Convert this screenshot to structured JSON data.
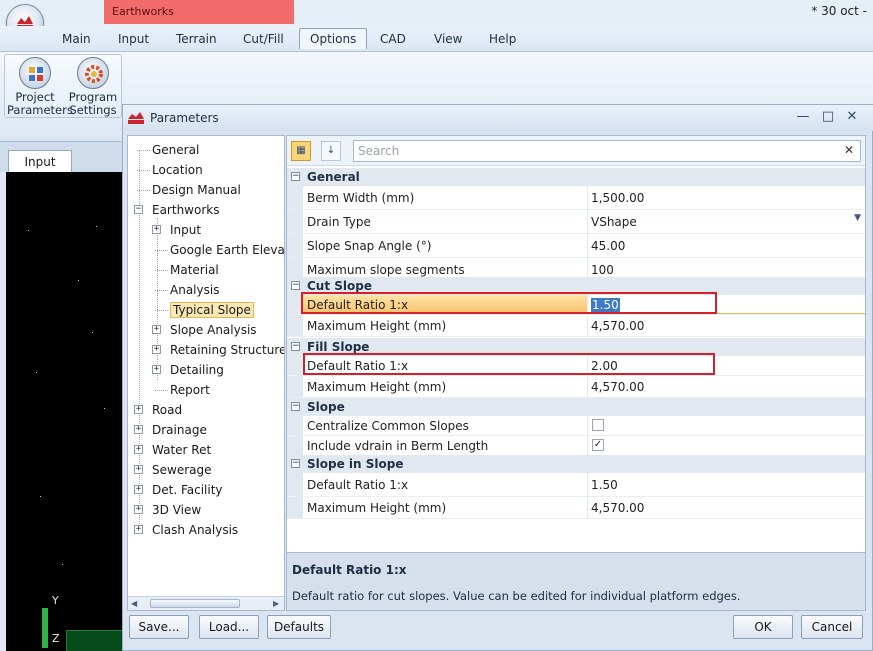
{
  "app": {
    "context_tab": "Earthworks",
    "doc_date": "* 30 oct -"
  },
  "menu": [
    "Main",
    "Input",
    "Terrain",
    "Cut/Fill",
    "Options",
    "CAD",
    "View",
    "Help"
  ],
  "ribbon": {
    "project_parameters": "Project Parameters",
    "program_settings": "Program Settings"
  },
  "doc_tab": "Input",
  "viewport": {
    "axis_y": "Y",
    "axis_z": "Z"
  },
  "dialog": {
    "title": "Parameters",
    "tree": [
      {
        "label": "General",
        "expandable": false
      },
      {
        "label": "Location",
        "expandable": false
      },
      {
        "label": "Design Manual",
        "expandable": false
      },
      {
        "label": "Earthworks",
        "expandable": true,
        "expanded": true
      },
      {
        "label": "Input",
        "expandable": true
      },
      {
        "label": "Google Earth Elevation",
        "expandable": false
      },
      {
        "label": "Material",
        "expandable": false
      },
      {
        "label": "Analysis",
        "expandable": false
      },
      {
        "label": "Typical Slope",
        "expandable": false,
        "selected": true
      },
      {
        "label": "Slope Analysis",
        "expandable": true
      },
      {
        "label": "Retaining Structures",
        "expandable": true
      },
      {
        "label": "Detailing",
        "expandable": true
      },
      {
        "label": "Report",
        "expandable": false
      },
      {
        "label": "Road",
        "expandable": true
      },
      {
        "label": "Drainage",
        "expandable": true
      },
      {
        "label": "Water Ret",
        "expandable": true
      },
      {
        "label": "Sewerage",
        "expandable": true
      },
      {
        "label": "Det. Facility",
        "expandable": true
      },
      {
        "label": "3D View",
        "expandable": true
      },
      {
        "label": "Clash Analysis",
        "expandable": true
      }
    ],
    "search_placeholder": "Search",
    "categories": [
      {
        "name": "General",
        "props": [
          {
            "name": "Berm Width (mm)",
            "value": "1,500.00"
          },
          {
            "name": "Drain Type",
            "value": "VShape",
            "dropdown": true
          },
          {
            "name": "Slope Snap Angle (°)",
            "value": "45.00"
          },
          {
            "name": "Maximum slope segments",
            "value": "100"
          }
        ]
      },
      {
        "name": "Cut Slope",
        "props": [
          {
            "name": "Default Ratio 1:x",
            "value": "1.50",
            "selected": true
          },
          {
            "name": "Maximum Height (mm)",
            "value": "4,570.00"
          }
        ]
      },
      {
        "name": "Fill Slope",
        "props": [
          {
            "name": "Default Ratio 1:x",
            "value": "2.00"
          },
          {
            "name": "Maximum Height (mm)",
            "value": "4,570.00"
          }
        ]
      },
      {
        "name": "Slope",
        "props": [
          {
            "name": "Centralize Common Slopes",
            "checkbox": true,
            "checked": false
          },
          {
            "name": "Include vdrain in Berm Length",
            "checkbox": true,
            "checked": true
          }
        ]
      },
      {
        "name": "Slope in Slope",
        "props": [
          {
            "name": "Default Ratio 1:x",
            "value": "1.50"
          },
          {
            "name": "Maximum Height (mm)",
            "value": "4,570.00"
          }
        ]
      }
    ],
    "description": {
      "title": "Default Ratio 1:x",
      "text": "Default ratio for cut slopes. Value can be edited for individual platform edges."
    },
    "buttons": {
      "save": "Save...",
      "load": "Load...",
      "defaults": "Defaults",
      "ok": "OK",
      "cancel": "Cancel"
    }
  },
  "colors": {
    "accent_selection": "#f8c26a",
    "highlight_box": "#d4202a",
    "context_tab": "#f26b6b"
  }
}
